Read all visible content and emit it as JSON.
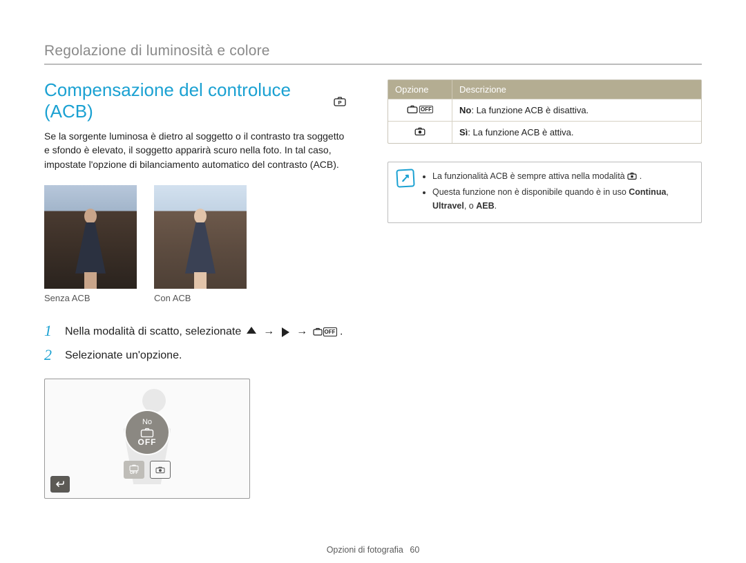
{
  "breadcrumb": "Regolazione di luminosità e colore",
  "title": "Compensazione del controluce (ACB)",
  "intro_paragraph": "Se la sorgente luminosa è dietro al soggetto o il contrasto tra soggetto e sfondo è elevato, il soggetto apparirà scuro nella foto. In tal caso, impostate l'opzione di bilanciamento automatico del contrasto (ACB).",
  "samples": {
    "without_label": "Senza ACB",
    "with_label": "Con ACB"
  },
  "steps": [
    {
      "num": "1",
      "text_before": "Nella modalità di scatto, selezionate ",
      "text_after": "."
    },
    {
      "num": "2",
      "text": "Selezionate un'opzione."
    }
  ],
  "option_screen": {
    "bubble_label": "No",
    "bubble_off_text": "OFF",
    "mini_off_text": "OFF"
  },
  "table": {
    "header_option": "Opzione",
    "header_description": "Descrizione",
    "rows": [
      {
        "desc_bold": "No",
        "desc_rest": ": La funzione ACB è disattiva."
      },
      {
        "desc_bold": "Sì",
        "desc_rest": ": La funzione ACB è attiva."
      }
    ]
  },
  "note": {
    "bullets": [
      {
        "pre": "La funzionalità ACB è sempre attiva nella modalità ",
        "post": "."
      },
      {
        "pre": "Questa funzione non è disponibile quando è in uso ",
        "bold1": "Continua",
        "mid": ", ",
        "bold2": "Ultravel",
        "mid2": ", o ",
        "bold3": "AEB",
        "post": "."
      }
    ]
  },
  "footer": {
    "section": "Opzioni di fotografia",
    "page": "60"
  }
}
